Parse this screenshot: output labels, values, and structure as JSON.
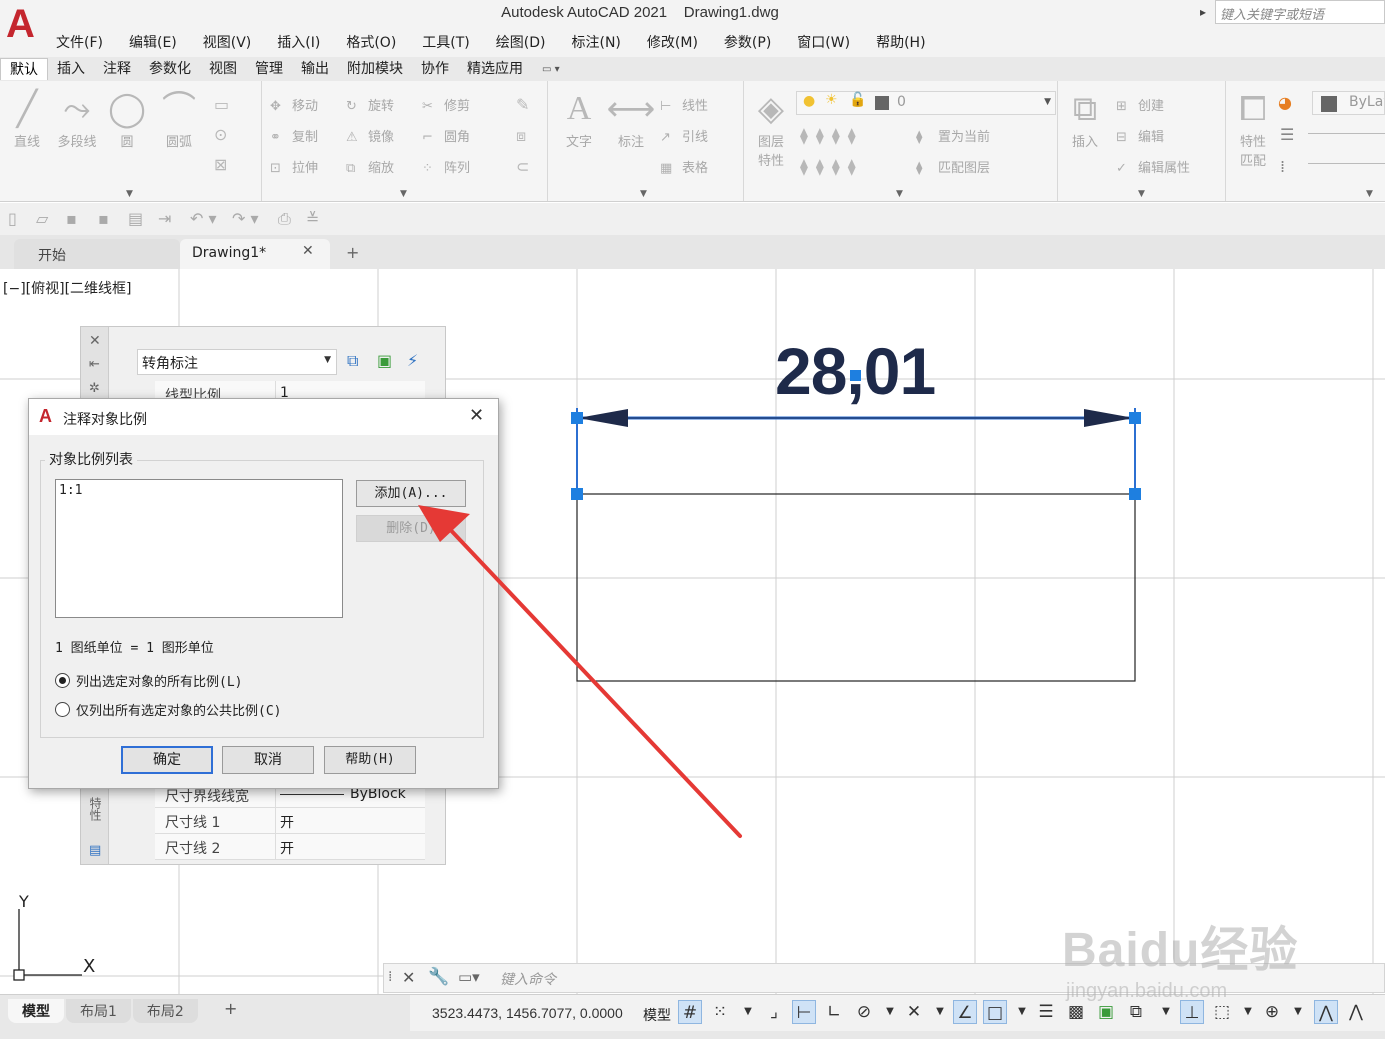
{
  "window": {
    "title": "Autodesk AutoCAD 2021    Drawing1.dwg",
    "search_placeholder": "键入关键字或短语"
  },
  "menu": [
    "文件(F)",
    "编辑(E)",
    "视图(V)",
    "插入(I)",
    "格式(O)",
    "工具(T)",
    "绘图(D)",
    "标注(N)",
    "修改(M)",
    "参数(P)",
    "窗口(W)",
    "帮助(H)"
  ],
  "ribbon_tabs": [
    "默认",
    "插入",
    "注释",
    "参数化",
    "视图",
    "管理",
    "输出",
    "附加模块",
    "协作",
    "精选应用"
  ],
  "ribbon": {
    "draw": {
      "line": "直线",
      "polyline": "多段线",
      "circle": "圆",
      "arc": "圆弧"
    },
    "modify": {
      "move": "移动",
      "rotate": "旋转",
      "trim": "修剪",
      "copy": "复制",
      "mirror": "镜像",
      "fillet": "圆角",
      "stretch": "拉伸",
      "scale": "缩放",
      "array": "阵列"
    },
    "annotation": {
      "text": "文字",
      "dimension": "标注",
      "linear": "线性",
      "leader": "引线",
      "table": "表格"
    },
    "layers": {
      "layer_props": "图层\n特性",
      "current_layer": "0",
      "set_current": "置为当前",
      "match_layer": "匹配图层"
    },
    "block": {
      "insert": "插入",
      "create": "创建",
      "edit": "编辑",
      "edit_attr": "编辑属性"
    },
    "properties": {
      "match": "特性\n匹配",
      "bylayer": "ByLayer"
    }
  },
  "doc_tabs": {
    "start": "开始",
    "drawing": "Drawing1*"
  },
  "viewport": {
    "label": "[−][俯视][二维线框]"
  },
  "drawing": {
    "dimension_text": "28,01"
  },
  "palette": {
    "combo": "转角标注",
    "side_label": "特性",
    "rows_top": [
      {
        "key": "线型比例",
        "value": "1"
      }
    ],
    "rows_bottom": [
      {
        "key": "尺寸界线线宽",
        "value": "ByBlock"
      },
      {
        "key": "尺寸线 1",
        "value": "开"
      },
      {
        "key": "尺寸线 2",
        "value": "开"
      }
    ]
  },
  "dialog": {
    "title": "注释对象比例",
    "group_label": "对象比例列表",
    "list_items": [
      "1:1"
    ],
    "add_button": "添加(A)...",
    "delete_button": "删除(D)",
    "units_text": "1 图纸单位 = 1 图形单位",
    "radio_all": "列出选定对象的所有比例(L)",
    "radio_common": "仅列出所有选定对象的公共比例(C)",
    "ok": "确定",
    "cancel": "取消",
    "help": "帮助(H)"
  },
  "ucs": {
    "x": "X",
    "y": "Y"
  },
  "command_line": {
    "placeholder": "键入命令"
  },
  "watermark": {
    "brand": "Baidu经验",
    "url": "jingyan.baidu.com"
  },
  "layout_tabs": [
    "模型",
    "布局1",
    "布局2"
  ],
  "status": {
    "coords": "3523.4473, 1456.7077, 0.0000",
    "model": "模型"
  },
  "colors": {
    "accent": "#2f6fd6",
    "annotation_arrow": "#e53935",
    "grip": "#1e7fe0",
    "dimension": "#1e2a4a",
    "logo": "#c4262e"
  }
}
